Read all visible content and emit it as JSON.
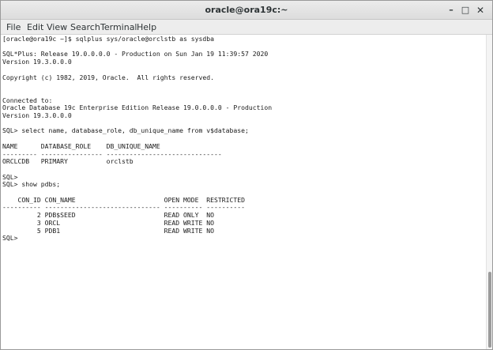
{
  "window": {
    "title": "oracle@ora19c:~",
    "min_glyph": "–",
    "max_glyph": "□",
    "close_glyph": "✕"
  },
  "menu": [
    "File",
    "Edit",
    "View",
    "Search",
    "Terminal",
    "Help"
  ],
  "terminal": {
    "lines": [
      "[oracle@ora19c ~]$ sqlplus sys/oracle@orclstb as sysdba",
      "",
      "SQL*Plus: Release 19.0.0.0.0 - Production on Sun Jan 19 11:39:57 2020",
      "Version 19.3.0.0.0",
      "",
      "Copyright (c) 1982, 2019, Oracle.  All rights reserved.",
      "",
      "",
      "Connected to:",
      "Oracle Database 19c Enterprise Edition Release 19.0.0.0.0 - Production",
      "Version 19.3.0.0.0",
      "",
      "SQL> select name, database_role, db_unique_name from v$database;",
      "",
      "NAME      DATABASE_ROLE    DB_UNIQUE_NAME",
      "--------- ---------------- ------------------------------",
      "ORCLCDB   PRIMARY          orclstb",
      "",
      "SQL>",
      "SQL> show pdbs;",
      "",
      "    CON_ID CON_NAME                       OPEN MODE  RESTRICTED",
      "---------- ------------------------------ ---------- ----------",
      "         2 PDB$SEED                       READ ONLY  NO",
      "         3 ORCL                           READ WRITE NO",
      "         5 PDB1                           READ WRITE NO",
      "SQL>"
    ]
  }
}
